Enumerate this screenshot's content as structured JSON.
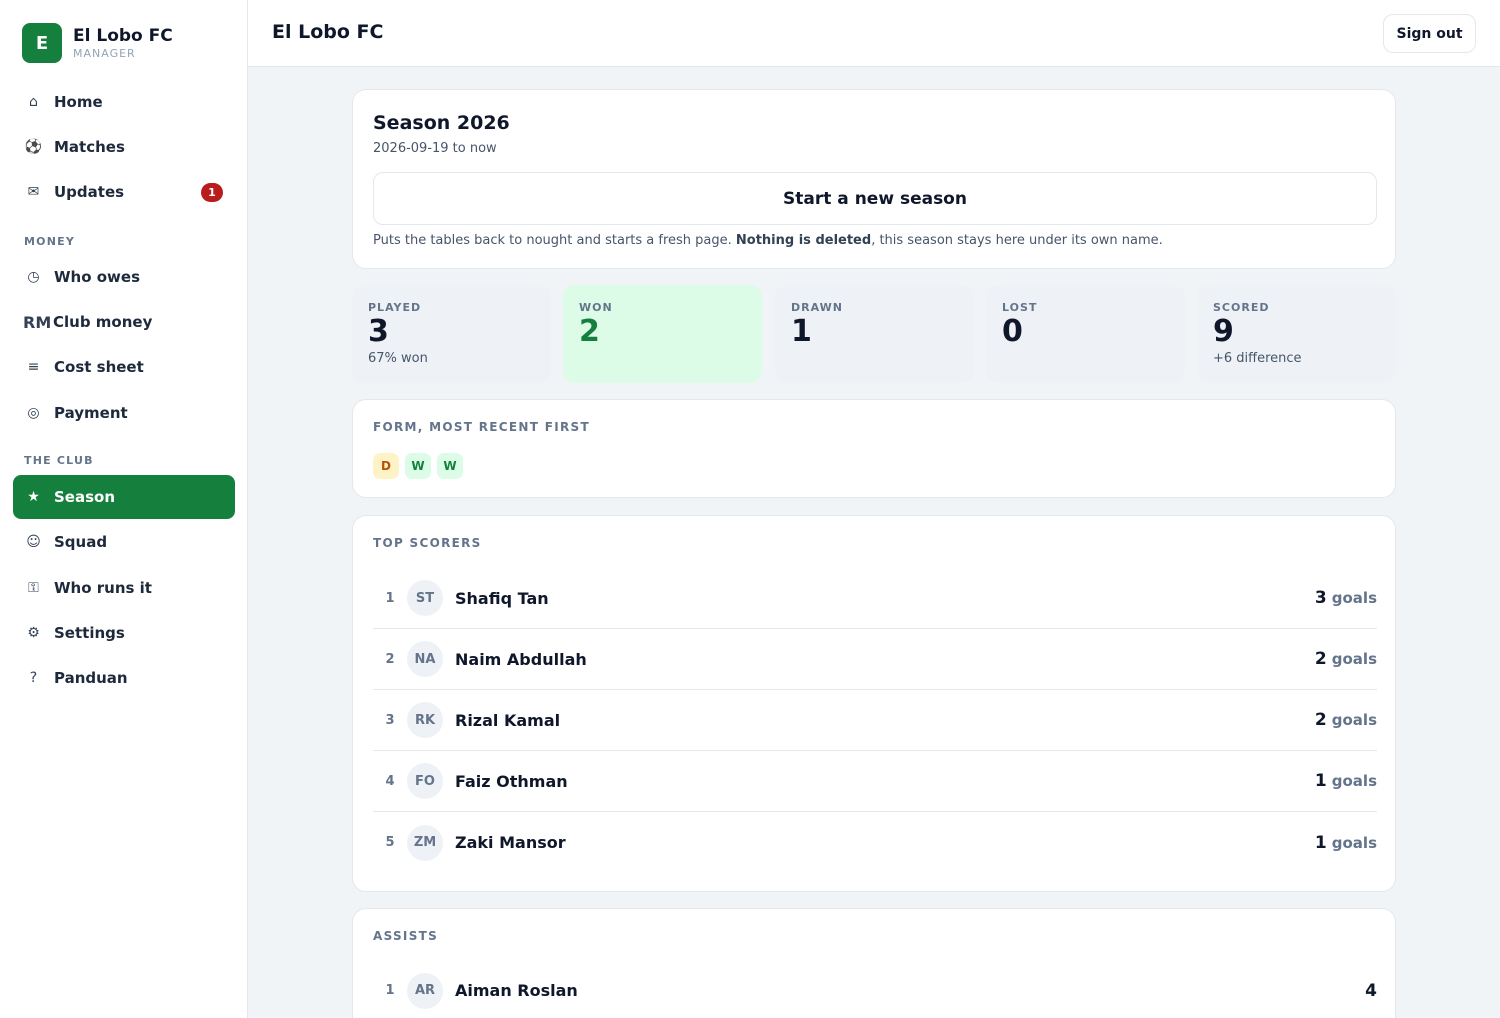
{
  "app": {
    "name": "El Lobo FC",
    "role": "MANAGER",
    "logo_letter": "E"
  },
  "sidebar": {
    "items": [
      {
        "key": "home",
        "label": "Home",
        "icon": "⌂",
        "icon_name": "home-icon"
      },
      {
        "key": "matches",
        "label": "Matches",
        "icon": "⚽",
        "icon_name": "football-icon"
      },
      {
        "key": "updates",
        "label": "Updates",
        "icon": "✉",
        "icon_name": "mail-icon",
        "badge": "1"
      }
    ],
    "money_section": "MONEY",
    "money_items": [
      {
        "key": "who-owes",
        "label": "Who owes",
        "icon": "◷",
        "icon_name": "clock-icon"
      },
      {
        "key": "club-money",
        "label": "Club money",
        "icon": "RM",
        "icon_name": "currency-rm-icon"
      },
      {
        "key": "cost-sheet",
        "label": "Cost sheet",
        "icon": "≡",
        "icon_name": "list-icon"
      },
      {
        "key": "payment",
        "label": "Payment",
        "icon": "◎",
        "icon_name": "target-icon"
      }
    ],
    "club_section": "THE CLUB",
    "club_items": [
      {
        "key": "season",
        "label": "Season",
        "icon": "★",
        "icon_name": "star-icon",
        "active": true
      },
      {
        "key": "squad",
        "label": "Squad",
        "icon": "☺",
        "icon_name": "smile-icon"
      },
      {
        "key": "who-runs-it",
        "label": "Who runs it",
        "icon": "⚿",
        "icon_name": "key-icon"
      },
      {
        "key": "settings",
        "label": "Settings",
        "icon": "⚙",
        "icon_name": "gear-icon"
      },
      {
        "key": "panduan",
        "label": "Panduan",
        "icon": "?",
        "icon_name": "help-icon"
      }
    ]
  },
  "header": {
    "title": "El Lobo FC",
    "signout_label": "Sign out"
  },
  "season": {
    "title": "Season 2026",
    "dates": "2026-09-19 to now",
    "new_season_label": "Start a new season",
    "note_before": "Puts the tables back to nought and starts a fresh page. ",
    "note_bold": "Nothing is deleted",
    "note_after": ", this season stays here under its own name."
  },
  "stats": [
    {
      "label": "PLAYED",
      "value": "3",
      "sub": "67% won"
    },
    {
      "label": "WON",
      "value": "2",
      "sub": ""
    },
    {
      "label": "DRAWN",
      "value": "1",
      "sub": ""
    },
    {
      "label": "LOST",
      "value": "0",
      "sub": ""
    },
    {
      "label": "SCORED",
      "value": "9",
      "sub": "+6 difference"
    }
  ],
  "form": {
    "label": "FORM, MOST RECENT FIRST",
    "results": [
      "D",
      "W",
      "W"
    ]
  },
  "top_scorers": {
    "label": "TOP SCORERS",
    "unit": "goals",
    "rows": [
      {
        "rank": "1",
        "initials": "ST",
        "name": "Shafiq Tan",
        "value": "3"
      },
      {
        "rank": "2",
        "initials": "NA",
        "name": "Naim Abdullah",
        "value": "2"
      },
      {
        "rank": "3",
        "initials": "RK",
        "name": "Rizal Kamal",
        "value": "2"
      },
      {
        "rank": "4",
        "initials": "FO",
        "name": "Faiz Othman",
        "value": "1"
      },
      {
        "rank": "5",
        "initials": "ZM",
        "name": "Zaki Mansor",
        "value": "1"
      }
    ]
  },
  "assists": {
    "label": "ASSISTS",
    "rows": [
      {
        "rank": "1",
        "initials": "AR",
        "name": "Aiman Roslan",
        "value": "4"
      }
    ]
  }
}
